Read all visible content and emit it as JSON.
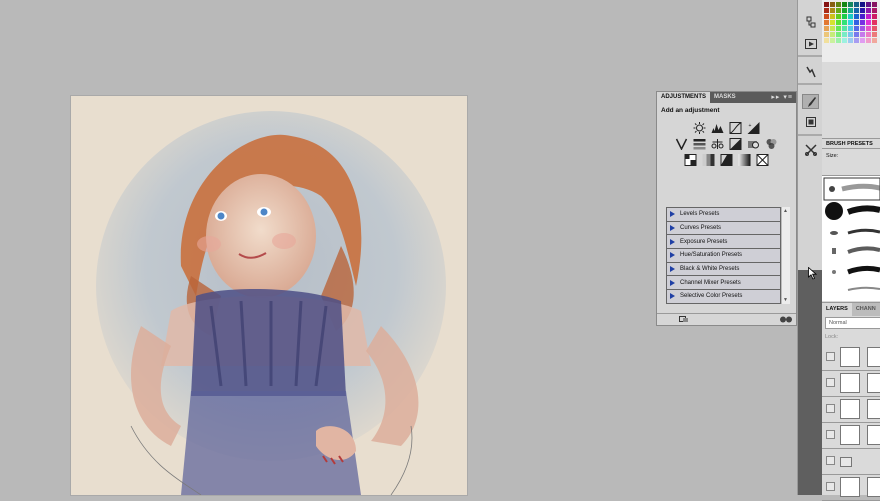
{
  "adjustments_panel": {
    "tabs": [
      "ADJUSTMENTS",
      "MASKS"
    ],
    "heading": "Add an adjustment",
    "icon_rows": [
      [
        "brightness-contrast-icon",
        "levels-icon",
        "curves-icon",
        "exposure-icon"
      ],
      [
        "vibrance-icon",
        "hue-saturation-icon",
        "color-balance-icon",
        "black-white-icon",
        "photo-filter-icon",
        "channel-mixer-icon"
      ],
      [
        "invert-icon",
        "posterize-icon",
        "threshold-icon",
        "gradient-map-icon",
        "selective-color-icon"
      ]
    ],
    "presets": [
      "Levels Presets",
      "Curves Presets",
      "Exposure Presets",
      "Hue/Saturation Presets",
      "Black & White Presets",
      "Channel Mixer Presets",
      "Selective Color Presets"
    ]
  },
  "brush_presets": {
    "title": "BRUSH PRESETS",
    "size_label": "Size:"
  },
  "layers_panel": {
    "tabs": [
      "LAYERS",
      "CHANN"
    ],
    "blend_mode": "Normal",
    "lock_label": "Lock:"
  },
  "colors": {
    "canvas_bg": "#b9b9b9",
    "panel_bg": "#d6d6d6",
    "preset_arrow": "#1f3fa5"
  }
}
